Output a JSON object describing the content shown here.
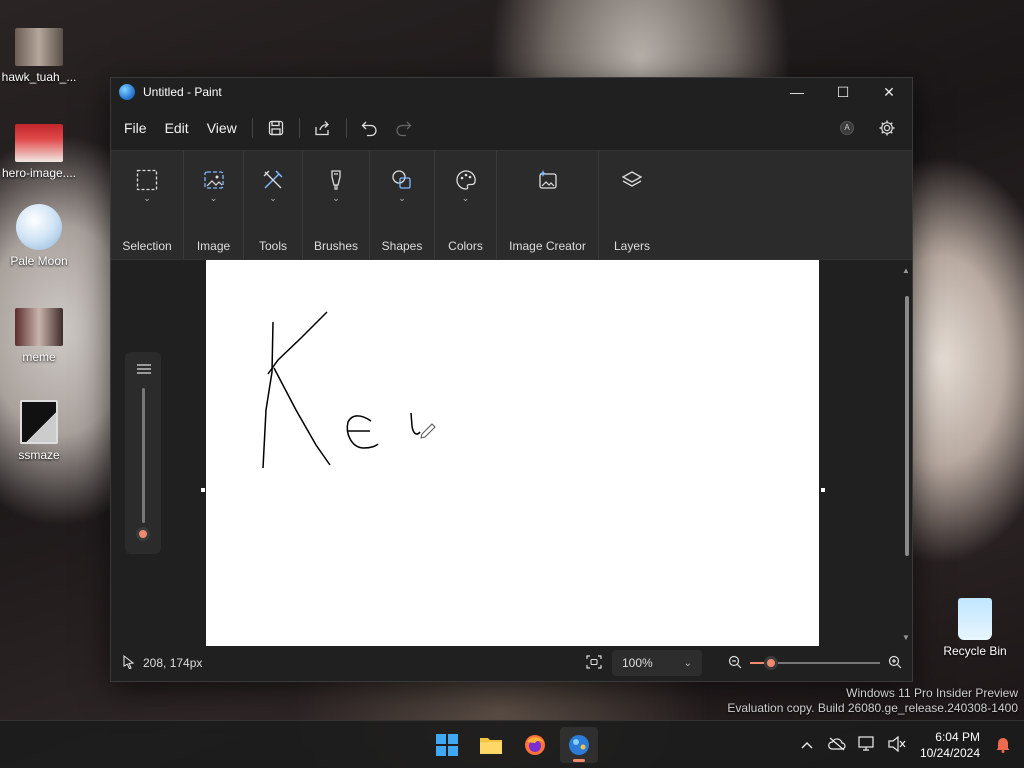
{
  "desktop": {
    "icons": [
      {
        "label": "hawk_tuah_..."
      },
      {
        "label": "hero-image...."
      },
      {
        "label": "Pale Moon"
      },
      {
        "label": "meme"
      },
      {
        "label": "ssmaze"
      },
      {
        "label": "Recycle Bin"
      }
    ],
    "watermark": {
      "line1": "Windows 11 Pro Insider Preview",
      "line2": "Evaluation copy. Build 26080.ge_release.240308-1400"
    }
  },
  "window": {
    "title": "Untitled - Paint",
    "controls": {
      "minimize": "—",
      "maximize": "☐",
      "close": "✕"
    }
  },
  "menu": {
    "file": "File",
    "edit": "Edit",
    "view": "View"
  },
  "ribbon": {
    "groups": [
      {
        "label": "Selection"
      },
      {
        "label": "Image"
      },
      {
        "label": "Tools"
      },
      {
        "label": "Brushes"
      },
      {
        "label": "Shapes"
      },
      {
        "label": "Colors"
      },
      {
        "label": "Image Creator"
      },
      {
        "label": "Layers"
      }
    ]
  },
  "status": {
    "cursor_position": "208, 174px",
    "zoom_value": "100%",
    "zoom_level_fraction": 0.16
  },
  "taskbar": {
    "time": "6:04 PM",
    "date": "10/24/2024"
  },
  "colors": {
    "accent": "#ef8a6c",
    "window_bg": "#202020",
    "ribbon_bg": "#2b2b2b"
  }
}
